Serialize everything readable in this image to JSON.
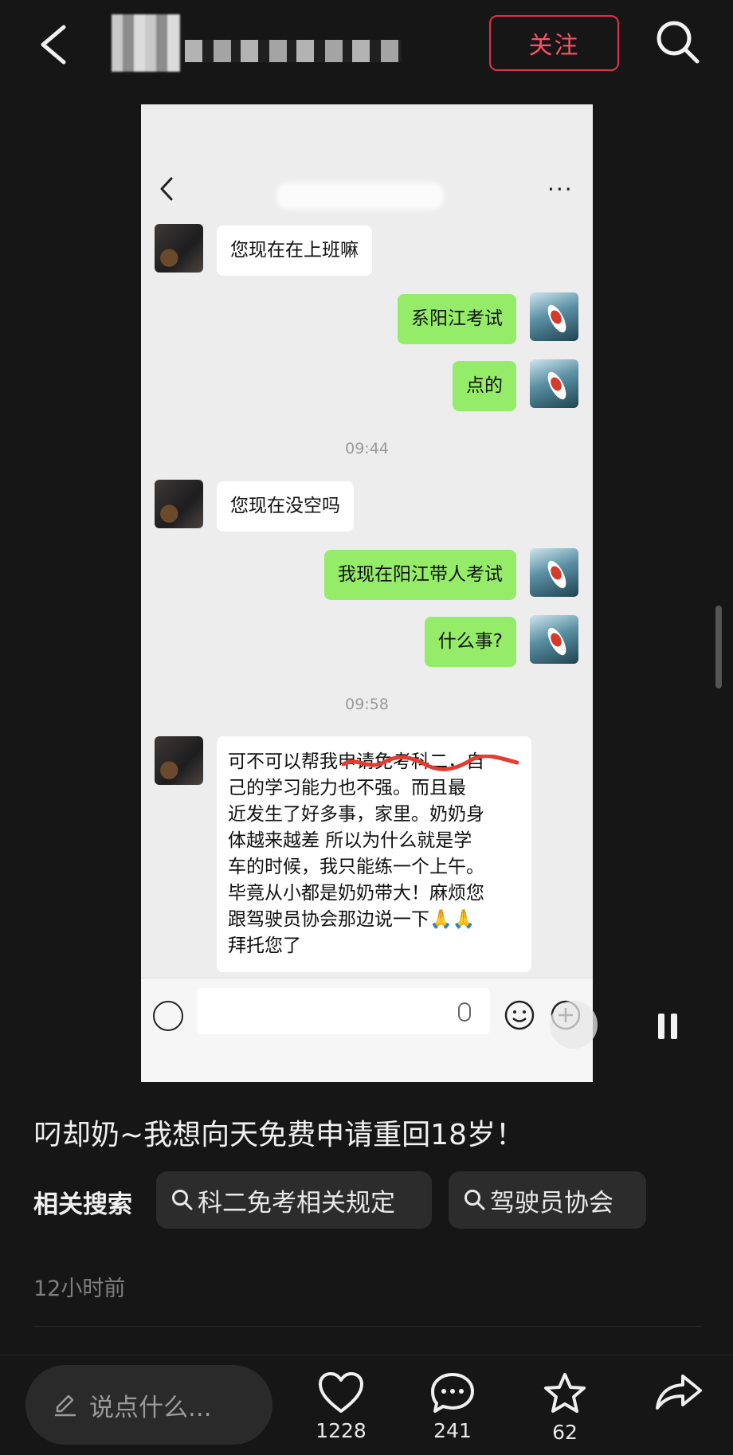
{
  "header": {
    "follow_label": "关注"
  },
  "chat": {
    "more_label": "···",
    "messages": [
      {
        "side": "in",
        "text": "您现在在上班嘛"
      },
      {
        "side": "out",
        "text": "系阳江考试"
      },
      {
        "side": "out",
        "text": "点的"
      },
      {
        "side": "time",
        "text": "09:44"
      },
      {
        "side": "in",
        "text": "您现在没空吗"
      },
      {
        "side": "out",
        "text": "我现在阳江带人考试"
      },
      {
        "side": "out",
        "text": "什么事?"
      },
      {
        "side": "time",
        "text": "09:58"
      },
      {
        "side": "in",
        "lines": [
          "可不可以帮我申请免考科二，自",
          "己的学习能力也不强。而且最",
          "近发生了好多事，家里。奶奶身",
          "体越来越差 所以为什么就是学",
          "车的时候，我只能练一个上午。",
          "毕竟从小都是奶奶带大！麻烦您",
          "跟驾驶员协会那边说一下🙏🙏",
          "拜托您了"
        ]
      }
    ]
  },
  "post": {
    "caption": "叼却奶~我想向天免费申请重回18岁！",
    "related_label": "相关搜索",
    "related": [
      "科二免考相关规定",
      "驾驶员协会"
    ],
    "time_ago": "12小时前"
  },
  "bottom": {
    "comment_placeholder": "说点什么...",
    "likes": "1228",
    "comments": "241",
    "favorites": "62"
  }
}
